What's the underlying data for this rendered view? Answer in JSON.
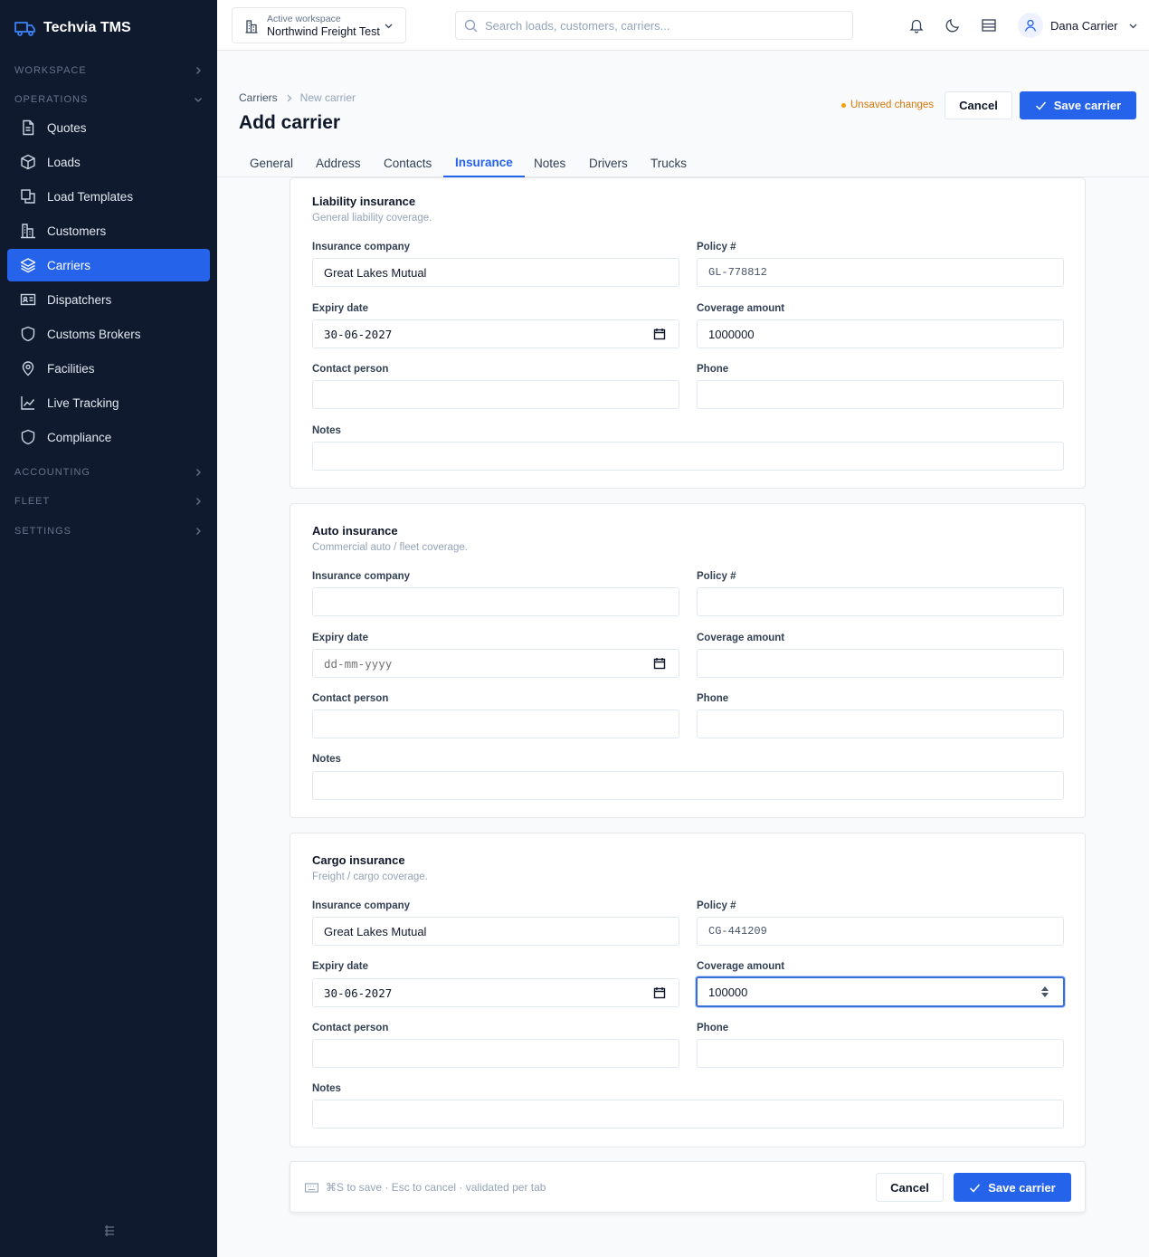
{
  "app": {
    "name": "Techvia TMS"
  },
  "sidebar": {
    "sections": {
      "workspace": "WORKSPACE",
      "operations": "OPERATIONS",
      "accounting": "ACCOUNTING",
      "fleet": "FLEET",
      "settings": "SETTINGS"
    },
    "items": [
      {
        "label": "Quotes",
        "icon": "document-icon"
      },
      {
        "label": "Loads",
        "icon": "box-icon"
      },
      {
        "label": "Load Templates",
        "icon": "copy-icon"
      },
      {
        "label": "Customers",
        "icon": "building-icon"
      },
      {
        "label": "Carriers",
        "icon": "layers-icon",
        "active": true
      },
      {
        "label": "Dispatchers",
        "icon": "id-card-icon"
      },
      {
        "label": "Customs Brokers",
        "icon": "shield-icon"
      },
      {
        "label": "Facilities",
        "icon": "map-pin-icon"
      },
      {
        "label": "Live Tracking",
        "icon": "line-chart-icon"
      },
      {
        "label": "Compliance",
        "icon": "shield-icon"
      }
    ]
  },
  "topbar": {
    "workspace_label": "Active workspace",
    "workspace_name": "Northwind Freight Test",
    "search_placeholder": "Search loads, customers, carriers...",
    "user_name": "Dana Carrier"
  },
  "header": {
    "breadcrumb": [
      "Carriers",
      "New carrier"
    ],
    "title": "Add carrier",
    "unsaved": "Unsaved changes",
    "cancel": "Cancel",
    "save": "Save carrier"
  },
  "tabs": [
    "General",
    "Address",
    "Contacts",
    "Insurance",
    "Notes",
    "Drivers",
    "Trucks"
  ],
  "active_tab": "Insurance",
  "labels": {
    "company": "Insurance company",
    "policy": "Policy #",
    "expiry": "Expiry date",
    "coverage": "Coverage amount",
    "contact": "Contact person",
    "phone": "Phone",
    "notes": "Notes"
  },
  "date_placeholder": "dd-mm-yyyy",
  "sections": [
    {
      "title": "Liability insurance",
      "subtitle": "General liability coverage.",
      "company": "Great Lakes Mutual",
      "policy": "GL-778812",
      "expiry": "30-06-2027",
      "coverage": "1000000",
      "contact": "",
      "phone": "",
      "notes": ""
    },
    {
      "title": "Auto insurance",
      "subtitle": "Commercial auto / fleet coverage.",
      "company": "",
      "policy": "",
      "expiry": "",
      "coverage": "",
      "contact": "",
      "phone": "",
      "notes": ""
    },
    {
      "title": "Cargo insurance",
      "subtitle": "Freight / cargo coverage.",
      "company": "Great Lakes Mutual",
      "policy": "CG-441209",
      "expiry": "30-06-2027",
      "coverage": "100000",
      "contact": "",
      "phone": "",
      "notes": ""
    }
  ],
  "footer": {
    "hint": "⌘S to save · Esc to cancel · validated per tab",
    "cancel": "Cancel",
    "save": "Save carrier"
  },
  "colors": {
    "sidebar_bg": "#0f1a2e",
    "accent": "#2563eb",
    "warning": "#d97706"
  }
}
